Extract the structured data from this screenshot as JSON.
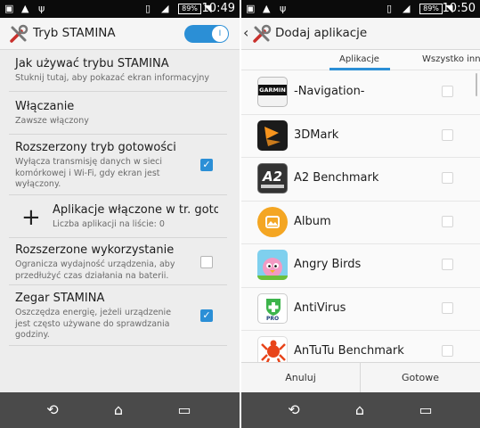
{
  "left": {
    "status": {
      "time": "10:49",
      "battery": "89%"
    },
    "header": {
      "title": "Tryb STAMINA"
    },
    "settings": [
      {
        "title": "Jak używać trybu STAMINA",
        "subtitle": "Stuknij tutaj, aby pokazać ekran informacyjny"
      },
      {
        "title": "Włączanie",
        "subtitle": "Zawsze włączony"
      },
      {
        "title": "Rozszerzony tryb gotowości",
        "subtitle": "Wyłącza transmisję danych w sieci komórkowej i Wi-Fi, gdy ekran jest wyłączony.",
        "checked": true
      },
      {
        "title": "Aplikacje włączone w tr. gotow",
        "subtitle": "Liczba aplikacji na liście: 0"
      },
      {
        "title": "Rozszerzone wykorzystanie",
        "subtitle": "Ogranicza wydajność urządzenia, aby przedłużyć czas działania na baterii.",
        "checked": false
      },
      {
        "title": "Zegar STAMINA",
        "subtitle": "Oszczędza energię, jeżeli urządzenie jest często używane do sprawdzania godziny.",
        "checked": true
      }
    ]
  },
  "right": {
    "status": {
      "time": "10:50",
      "battery": "89%"
    },
    "header": {
      "title": "Dodaj aplikacje"
    },
    "tabs": [
      "Aplikacje",
      "Wszystko inne"
    ],
    "apps": [
      {
        "name": "-Navigation-",
        "icon": "garmin-navigation-icon",
        "icon_text": "GARMIN"
      },
      {
        "name": "3DMark",
        "icon": "3dmark-icon"
      },
      {
        "name": "A2 Benchmark",
        "icon": "a2-benchmark-icon",
        "icon_text": "A2"
      },
      {
        "name": "Album",
        "icon": "album-icon"
      },
      {
        "name": "Angry Birds",
        "icon": "angry-birds-icon"
      },
      {
        "name": "AntiVirus",
        "icon": "antivirus-icon",
        "icon_text": "PRO"
      },
      {
        "name": "AnTuTu Benchmark",
        "icon": "antutu-icon"
      }
    ],
    "buttons": {
      "cancel": "Anuluj",
      "done": "Gotowe"
    }
  }
}
